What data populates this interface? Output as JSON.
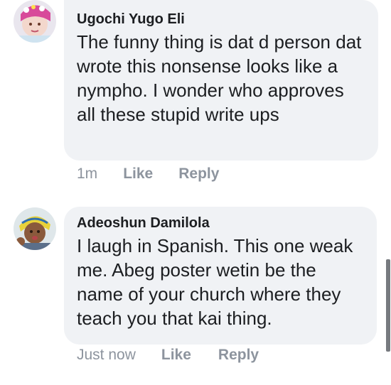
{
  "comments": [
    {
      "author": "Ugochi Yugo Eli",
      "text": "The funny thing is dat d person dat wrote this nonsense looks like a nympho.  I wonder who approves all these stupid write ups",
      "time": "1m",
      "like_label": "Like",
      "reply_label": "Reply",
      "avatar_icon": "profile-photo-avatar"
    },
    {
      "author": "Adeoshun Damilola",
      "text": "I laugh in Spanish. This one weak me. Abeg poster wetin be the name of your church where they teach you that kai thing.",
      "time": "Just now",
      "like_label": "Like",
      "reply_label": "Reply",
      "avatar_icon": "profile-photo-avatar"
    }
  ],
  "colors": {
    "bubble_bg": "#f0f2f5",
    "text": "#1c1e21",
    "meta": "#8d949e"
  }
}
